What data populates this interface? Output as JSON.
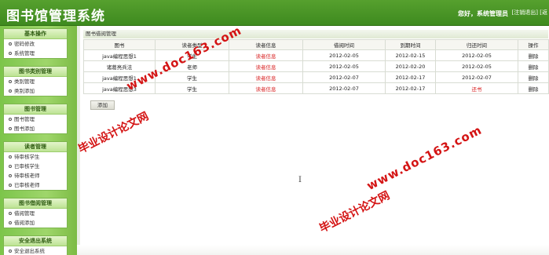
{
  "header": {
    "title": "图书馆管理系统",
    "welcome": "您好，系统管理员",
    "logout": "[注销退出] [返"
  },
  "sidebar": {
    "groups": [
      {
        "title": "基本操作",
        "items": [
          "密码修改",
          "系统管理"
        ]
      },
      {
        "title": "图书类别管理",
        "items": [
          "类别管理",
          "类别添加"
        ]
      },
      {
        "title": "图书管理",
        "items": [
          "图书管理",
          "图书添加"
        ]
      },
      {
        "title": "读者管理",
        "items": [
          "待审核学生",
          "已审核学生",
          "待审核老师",
          "已审核老师"
        ]
      },
      {
        "title": "图书借阅管理",
        "items": [
          "借阅管理",
          "借阅添加"
        ]
      },
      {
        "title": "安全退出系统",
        "items": [
          "安全退出系统"
        ]
      }
    ]
  },
  "main": {
    "panel_title": "图书借阅管理",
    "columns": [
      "图书",
      "读者类型",
      "读者信息",
      "借阅时间",
      "到期时间",
      "归还时间",
      "操作"
    ],
    "rows": [
      [
        "java编程思想1",
        "学生",
        "读者信息",
        "2012-02-05",
        "2012-02-15",
        "2012-02-05",
        "删除"
      ],
      [
        "诸葛亮兵法",
        "老师",
        "读者信息",
        "2012-02-05",
        "2012-02-20",
        "2012-02-05",
        "删除"
      ],
      [
        "java编程思想1",
        "学生",
        "读者信息",
        "2012-02-07",
        "2012-02-17",
        "2012-02-07",
        "删除"
      ],
      [
        "java编程思想3",
        "学生",
        "读者信息",
        "2012-02-07",
        "2012-02-17",
        "还书",
        "删除"
      ]
    ],
    "add_label": "添加"
  },
  "watermark": {
    "cn": "毕业设计论文网",
    "url": "www.doc163.com"
  },
  "colors": {
    "header_green": "#4a962a",
    "sidebar_green": "#8ccd5a",
    "accent_red": "#d81e1e"
  }
}
